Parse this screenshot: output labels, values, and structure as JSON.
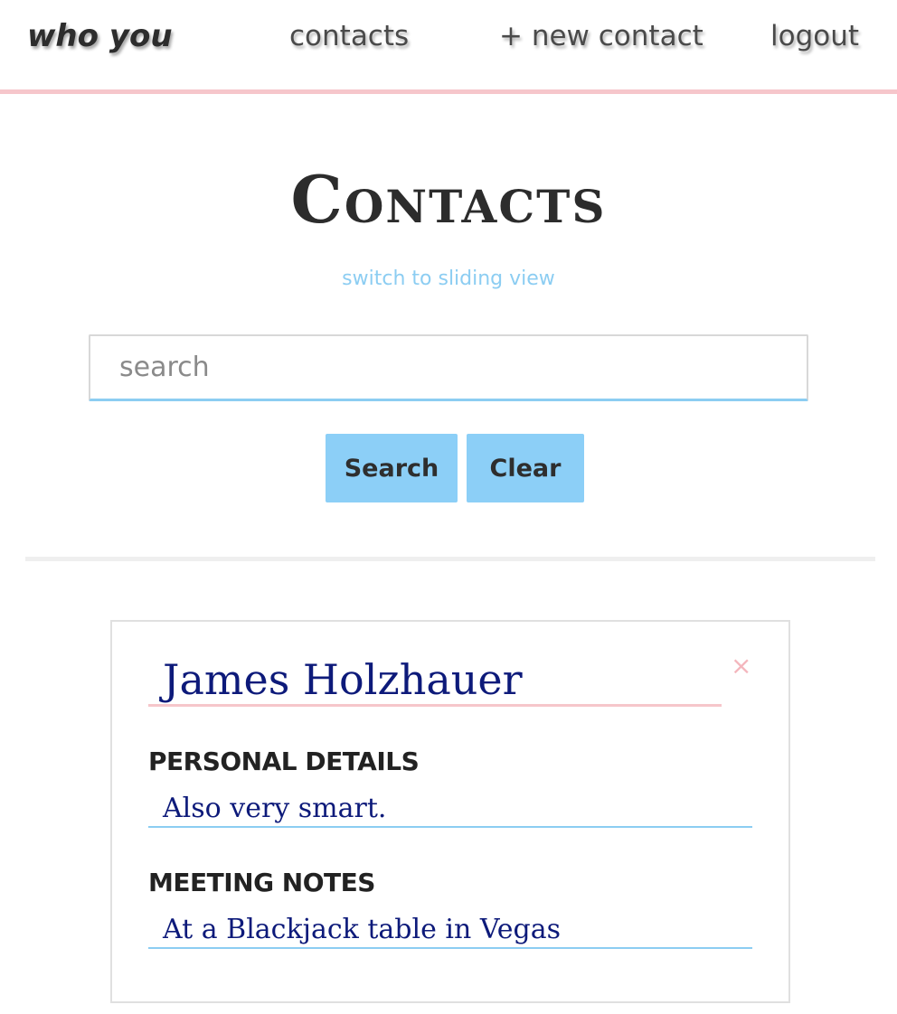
{
  "nav": {
    "brand": "WHO YOU",
    "contacts": "contacts",
    "new_contact": "+ new contact",
    "logout": "logout"
  },
  "main": {
    "title": "Contacts",
    "switch_view": "switch to sliding view",
    "search": {
      "placeholder": "search",
      "value": ""
    },
    "buttons": {
      "search": "Search",
      "clear": "Clear"
    }
  },
  "contact": {
    "name": "James Holzhauer",
    "close_icon": "×",
    "personal_details_label": "PERSONAL DETAILS",
    "personal_details": "Also very smart.",
    "meeting_notes_label": "MEETING NOTES",
    "meeting_notes": "At a Blackjack table in Vegas"
  },
  "colors": {
    "accent_pink": "#f6c6cb",
    "accent_blue": "#8ccff7",
    "ink_blue": "#0d1a7a"
  }
}
